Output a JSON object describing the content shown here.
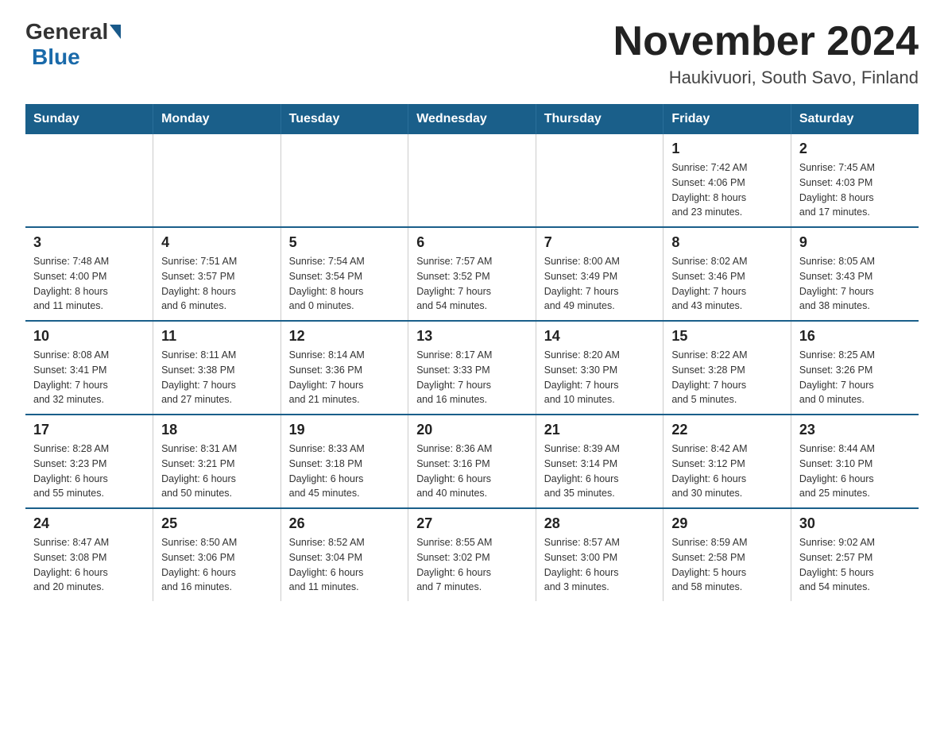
{
  "header": {
    "logo_general": "General",
    "logo_blue": "Blue",
    "title": "November 2024",
    "subtitle": "Haukivuori, South Savo, Finland"
  },
  "weekdays": [
    "Sunday",
    "Monday",
    "Tuesday",
    "Wednesday",
    "Thursday",
    "Friday",
    "Saturday"
  ],
  "weeks": [
    [
      {
        "day": "",
        "info": ""
      },
      {
        "day": "",
        "info": ""
      },
      {
        "day": "",
        "info": ""
      },
      {
        "day": "",
        "info": ""
      },
      {
        "day": "",
        "info": ""
      },
      {
        "day": "1",
        "info": "Sunrise: 7:42 AM\nSunset: 4:06 PM\nDaylight: 8 hours\nand 23 minutes."
      },
      {
        "day": "2",
        "info": "Sunrise: 7:45 AM\nSunset: 4:03 PM\nDaylight: 8 hours\nand 17 minutes."
      }
    ],
    [
      {
        "day": "3",
        "info": "Sunrise: 7:48 AM\nSunset: 4:00 PM\nDaylight: 8 hours\nand 11 minutes."
      },
      {
        "day": "4",
        "info": "Sunrise: 7:51 AM\nSunset: 3:57 PM\nDaylight: 8 hours\nand 6 minutes."
      },
      {
        "day": "5",
        "info": "Sunrise: 7:54 AM\nSunset: 3:54 PM\nDaylight: 8 hours\nand 0 minutes."
      },
      {
        "day": "6",
        "info": "Sunrise: 7:57 AM\nSunset: 3:52 PM\nDaylight: 7 hours\nand 54 minutes."
      },
      {
        "day": "7",
        "info": "Sunrise: 8:00 AM\nSunset: 3:49 PM\nDaylight: 7 hours\nand 49 minutes."
      },
      {
        "day": "8",
        "info": "Sunrise: 8:02 AM\nSunset: 3:46 PM\nDaylight: 7 hours\nand 43 minutes."
      },
      {
        "day": "9",
        "info": "Sunrise: 8:05 AM\nSunset: 3:43 PM\nDaylight: 7 hours\nand 38 minutes."
      }
    ],
    [
      {
        "day": "10",
        "info": "Sunrise: 8:08 AM\nSunset: 3:41 PM\nDaylight: 7 hours\nand 32 minutes."
      },
      {
        "day": "11",
        "info": "Sunrise: 8:11 AM\nSunset: 3:38 PM\nDaylight: 7 hours\nand 27 minutes."
      },
      {
        "day": "12",
        "info": "Sunrise: 8:14 AM\nSunset: 3:36 PM\nDaylight: 7 hours\nand 21 minutes."
      },
      {
        "day": "13",
        "info": "Sunrise: 8:17 AM\nSunset: 3:33 PM\nDaylight: 7 hours\nand 16 minutes."
      },
      {
        "day": "14",
        "info": "Sunrise: 8:20 AM\nSunset: 3:30 PM\nDaylight: 7 hours\nand 10 minutes."
      },
      {
        "day": "15",
        "info": "Sunrise: 8:22 AM\nSunset: 3:28 PM\nDaylight: 7 hours\nand 5 minutes."
      },
      {
        "day": "16",
        "info": "Sunrise: 8:25 AM\nSunset: 3:26 PM\nDaylight: 7 hours\nand 0 minutes."
      }
    ],
    [
      {
        "day": "17",
        "info": "Sunrise: 8:28 AM\nSunset: 3:23 PM\nDaylight: 6 hours\nand 55 minutes."
      },
      {
        "day": "18",
        "info": "Sunrise: 8:31 AM\nSunset: 3:21 PM\nDaylight: 6 hours\nand 50 minutes."
      },
      {
        "day": "19",
        "info": "Sunrise: 8:33 AM\nSunset: 3:18 PM\nDaylight: 6 hours\nand 45 minutes."
      },
      {
        "day": "20",
        "info": "Sunrise: 8:36 AM\nSunset: 3:16 PM\nDaylight: 6 hours\nand 40 minutes."
      },
      {
        "day": "21",
        "info": "Sunrise: 8:39 AM\nSunset: 3:14 PM\nDaylight: 6 hours\nand 35 minutes."
      },
      {
        "day": "22",
        "info": "Sunrise: 8:42 AM\nSunset: 3:12 PM\nDaylight: 6 hours\nand 30 minutes."
      },
      {
        "day": "23",
        "info": "Sunrise: 8:44 AM\nSunset: 3:10 PM\nDaylight: 6 hours\nand 25 minutes."
      }
    ],
    [
      {
        "day": "24",
        "info": "Sunrise: 8:47 AM\nSunset: 3:08 PM\nDaylight: 6 hours\nand 20 minutes."
      },
      {
        "day": "25",
        "info": "Sunrise: 8:50 AM\nSunset: 3:06 PM\nDaylight: 6 hours\nand 16 minutes."
      },
      {
        "day": "26",
        "info": "Sunrise: 8:52 AM\nSunset: 3:04 PM\nDaylight: 6 hours\nand 11 minutes."
      },
      {
        "day": "27",
        "info": "Sunrise: 8:55 AM\nSunset: 3:02 PM\nDaylight: 6 hours\nand 7 minutes."
      },
      {
        "day": "28",
        "info": "Sunrise: 8:57 AM\nSunset: 3:00 PM\nDaylight: 6 hours\nand 3 minutes."
      },
      {
        "day": "29",
        "info": "Sunrise: 8:59 AM\nSunset: 2:58 PM\nDaylight: 5 hours\nand 58 minutes."
      },
      {
        "day": "30",
        "info": "Sunrise: 9:02 AM\nSunset: 2:57 PM\nDaylight: 5 hours\nand 54 minutes."
      }
    ]
  ]
}
